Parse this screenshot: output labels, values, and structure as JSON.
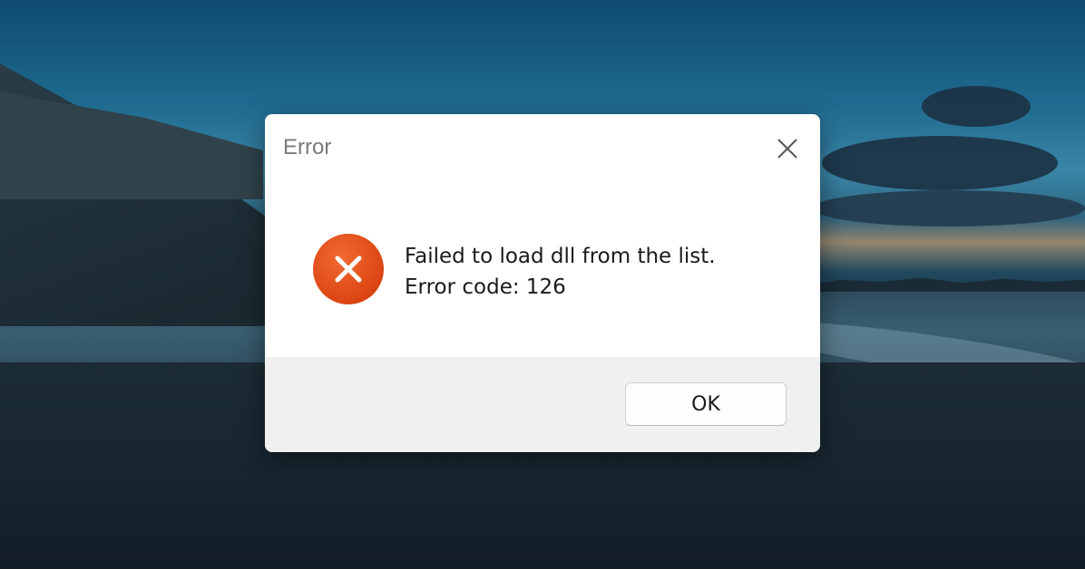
{
  "dialog": {
    "title": "Error",
    "message_line1": "Failed to load dll from the list.",
    "message_line2": "Error code: 126",
    "ok_label": "OK",
    "close_icon": "close-icon",
    "status_icon": "error-icon"
  },
  "colors": {
    "error_icon": "#e8501e",
    "title_text": "#7a7a7a",
    "footer_bg": "#f0f0f0"
  }
}
